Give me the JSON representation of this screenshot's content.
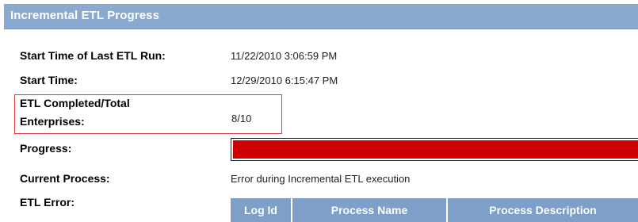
{
  "panel": {
    "title": "Incremental ETL Progress"
  },
  "fields": {
    "last_run_label": "Start Time of Last ETL Run:",
    "last_run_value": "11/22/2010 3:06:59 PM",
    "start_time_label": "Start Time:",
    "start_time_value": "12/29/2010 6:15:47 PM",
    "completed_label_line1": "ETL Completed/Total",
    "completed_label_line2": "Enterprises:",
    "completed_value": "8/10",
    "progress_label": "Progress:",
    "progress_fraction": 0.8,
    "current_process_label": "Current Process:",
    "current_process_value": "Error during Incremental ETL execution",
    "etl_error_label": "ETL Error:"
  },
  "error_table": {
    "columns": [
      "Log Id",
      "Process Name",
      "Process Description"
    ]
  },
  "colors": {
    "header_bg": "#89a9cf",
    "highlight_border": "#e03a3a",
    "progress_fill": "#cc0000",
    "table_header_bg": "#7e9fc8"
  }
}
